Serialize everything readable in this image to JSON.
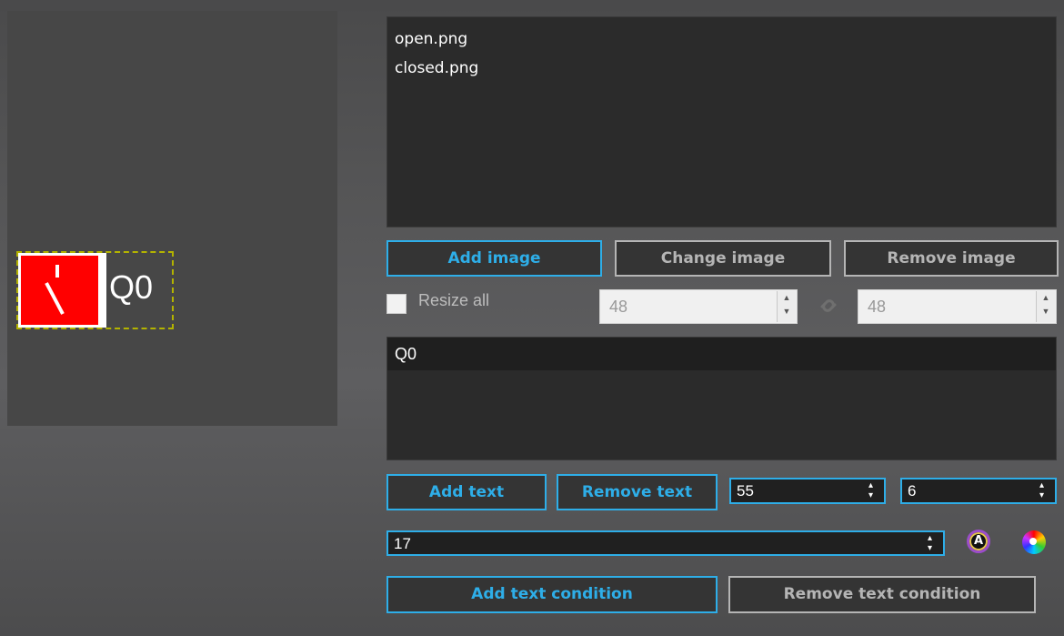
{
  "preview": {
    "symbol_label": "Q0"
  },
  "images": {
    "items": [
      "open.png",
      "closed.png"
    ]
  },
  "image_buttons": {
    "add": "Add image",
    "change": "Change image",
    "remove": "Remove image"
  },
  "resize": {
    "label": "Resize all",
    "checked": false,
    "width": "48",
    "height": "48"
  },
  "texts": {
    "items": [
      "Q0"
    ]
  },
  "text_buttons": {
    "add": "Add text",
    "remove": "Remove text"
  },
  "text_position": {
    "x": "55",
    "y": "6"
  },
  "font_size": "17",
  "condition_buttons": {
    "add": "Add text condition",
    "remove": "Remove text condition"
  },
  "colors": {
    "accent": "#2eaee8",
    "disabled": "#b5b5b5",
    "symbol_fill": "#ff0000",
    "frame": "#b3b300"
  },
  "icons": {
    "font_color": "font-color-icon",
    "background_color": "color-wheel-icon",
    "link": "link-icon"
  }
}
